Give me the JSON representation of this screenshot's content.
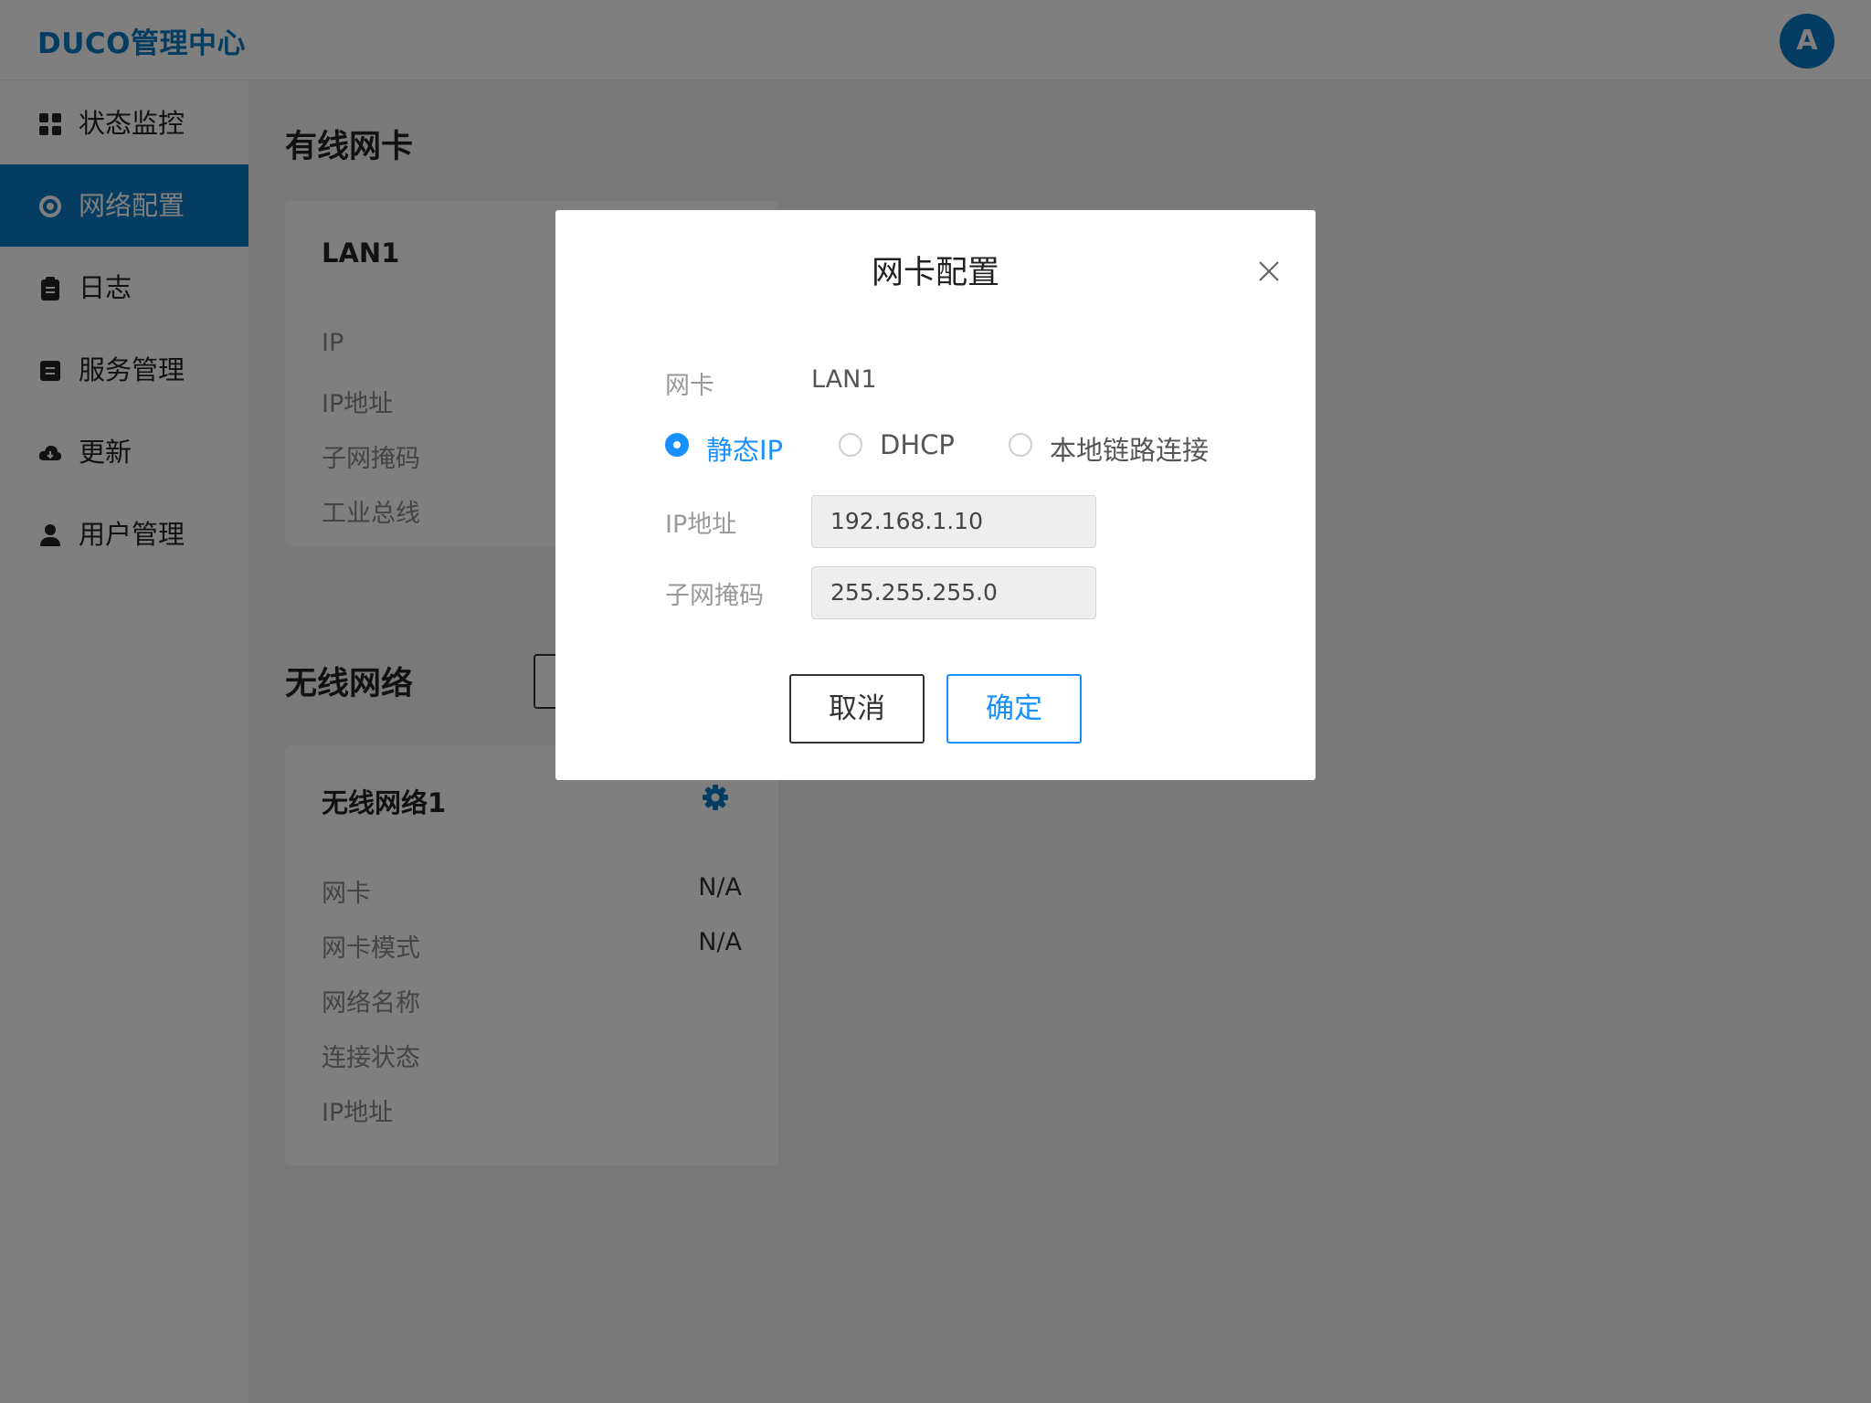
{
  "header": {
    "brand": "DUCO管理中心",
    "avatar_letter": "A"
  },
  "sidebar": {
    "items": [
      {
        "label": "状态监控",
        "icon": "dashboard-icon",
        "active": false
      },
      {
        "label": "网络配置",
        "icon": "network-icon",
        "active": true
      },
      {
        "label": "日志",
        "icon": "clipboard-icon",
        "active": false
      },
      {
        "label": "服务管理",
        "icon": "service-icon",
        "active": false
      },
      {
        "label": "更新",
        "icon": "cloud-icon",
        "active": false
      },
      {
        "label": "用户管理",
        "icon": "user-icon",
        "active": false
      }
    ]
  },
  "wired": {
    "title": "有线网卡",
    "card": {
      "title": "LAN1",
      "labels": [
        "IP",
        "IP地址",
        "子网掩码",
        "工业总线"
      ]
    }
  },
  "wireless": {
    "title": "无线网络",
    "card": {
      "title": "无线网络1",
      "rows": [
        {
          "label": "网卡",
          "value": "N/A"
        },
        {
          "label": "网卡模式",
          "value": "N/A"
        },
        {
          "label": "网络名称",
          "value": ""
        },
        {
          "label": "连接状态",
          "value": ""
        },
        {
          "label": "IP地址",
          "value": ""
        }
      ]
    }
  },
  "modal": {
    "title": "网卡配置",
    "nic_label": "网卡",
    "nic_value": "LAN1",
    "modes": [
      {
        "label": "静态IP",
        "checked": true
      },
      {
        "label": "DHCP",
        "checked": false
      },
      {
        "label": "本地链路连接",
        "checked": false
      }
    ],
    "ip_label": "IP地址",
    "ip_value": "192.168.1.10",
    "mask_label": "子网掩码",
    "mask_value": "255.255.255.0",
    "cancel_label": "取消",
    "ok_label": "确定"
  },
  "colors": {
    "accent": "#0a78c2",
    "primary": "#1890ff"
  }
}
